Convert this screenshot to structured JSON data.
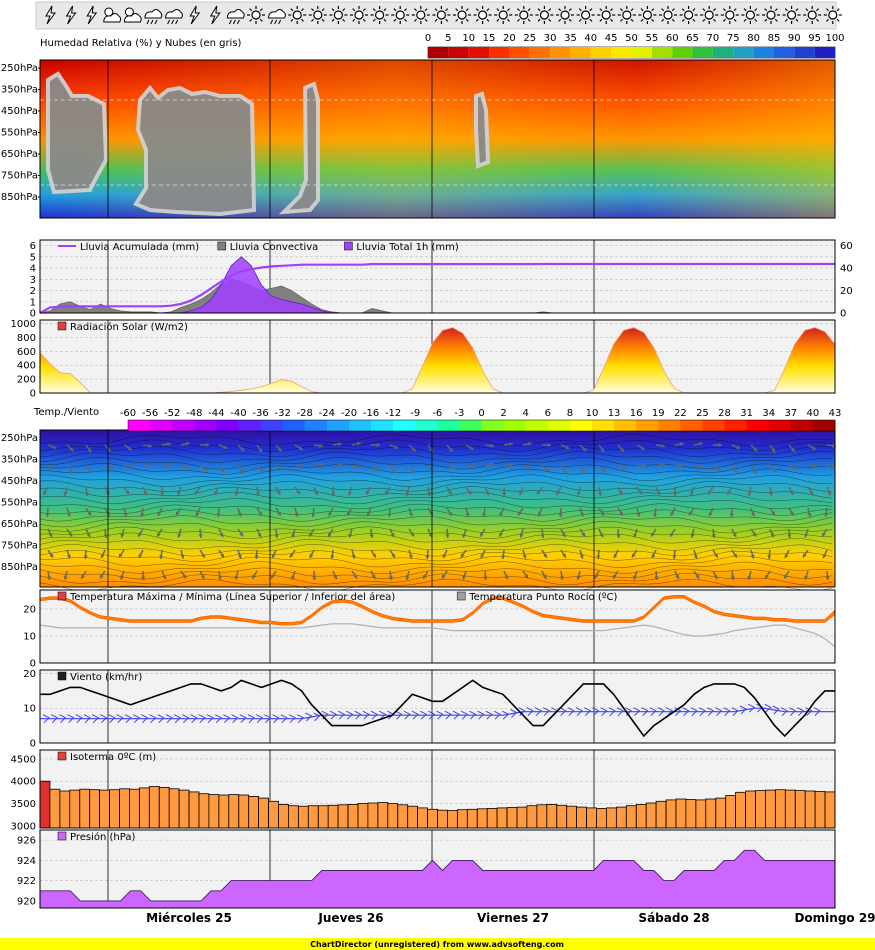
{
  "weather_icons": [
    "storm-icon",
    "storm-icon",
    "storm-icon",
    "cloud-sun-icon",
    "cloud-sun-icon",
    "cloud-rain-icon",
    "cloud-rain-icon",
    "storm-icon",
    "storm-icon",
    "cloud-rain-icon",
    "sun-icon",
    "cloud-rain-icon",
    "sun-icon",
    "sun-icon",
    "sun-icon",
    "sun-icon",
    "sun-icon",
    "sun-icon",
    "sun-icon",
    "sun-icon",
    "sun-icon",
    "sun-icon",
    "sun-icon",
    "sun-icon",
    "sun-icon",
    "sun-icon",
    "sun-icon",
    "sun-icon",
    "sun-icon",
    "sun-icon",
    "sun-icon",
    "sun-icon",
    "sun-icon",
    "sun-icon",
    "sun-icon",
    "sun-icon",
    "sun-icon",
    "sun-icon",
    "sun-icon"
  ],
  "days": [
    "Miércoles 25",
    "Jueves 26",
    "Viernes 27",
    "Sábado 28",
    "Domingo 29"
  ],
  "footer": "ChartDirector (unregistered) from www.advsofteng.com",
  "colors": {
    "humidity_low": "#2030d0",
    "humidity_high": "#c80000",
    "cloud": "#808080",
    "rain_total": "#a040ff",
    "rain_conv": "#808080",
    "radiation": "#ffcc00",
    "temp_max": "#ff8000",
    "dew": "#b0b0b0",
    "wind": "#000000",
    "gust": "#4040ff",
    "isotherm": "#ff9a40",
    "pressure": "#cc66ff"
  },
  "chart_data": [
    {
      "type": "heatmap",
      "title": "Humedad Relativa (%) y Nubes (en gris)",
      "y_ticks": [
        "250hPa",
        "350hPa",
        "450hPa",
        "550hPa",
        "650hPa",
        "750hPa",
        "850hPa"
      ],
      "scale_ticks": [
        "0",
        "5",
        "10",
        "15",
        "20",
        "25",
        "30",
        "35",
        "40",
        "45",
        "50",
        "55",
        "60",
        "65",
        "70",
        "75",
        "80",
        "85",
        "90",
        "95",
        "100"
      ]
    },
    {
      "type": "area",
      "legend": [
        "Lluvia Acumulada (mm)",
        "Lluvia Convectiva",
        "Lluvia Total 1h (mm)"
      ],
      "y_left_ticks": [
        "0",
        "1",
        "2",
        "3",
        "4",
        "5",
        "6"
      ],
      "y_right_ticks": [
        "0",
        "20",
        "40",
        "60"
      ],
      "ylim_left": [
        0,
        6.5
      ],
      "ylim_right": [
        0,
        65
      ],
      "rain_total_1h": [
        0,
        0,
        0,
        0,
        0,
        0,
        0,
        0,
        0,
        0,
        0,
        0,
        0,
        0,
        0,
        0.2,
        0.5,
        1.2,
        2.5,
        4.2,
        5.0,
        4.2,
        2.5,
        1.5,
        1.2,
        1.0,
        0.8,
        0.5,
        0.2,
        0,
        0,
        0,
        0,
        0,
        0,
        0,
        0,
        0,
        0,
        0,
        0,
        0,
        0,
        0,
        0,
        0,
        0,
        0,
        0,
        0,
        0,
        0,
        0,
        0,
        0,
        0,
        0,
        0,
        0,
        0,
        0,
        0,
        0,
        0,
        0,
        0,
        0,
        0,
        0,
        0,
        0,
        0,
        0,
        0,
        0,
        0,
        0,
        0,
        0,
        0
      ],
      "rain_convective": [
        0,
        0.2,
        0.8,
        1.0,
        0.6,
        0.3,
        0.8,
        0.4,
        0.2,
        0.1,
        0.1,
        0.1,
        0,
        0.1,
        0.5,
        0.8,
        1.2,
        1.8,
        2.6,
        3.0,
        2.8,
        2.4,
        2.0,
        2.2,
        2.4,
        2.0,
        1.4,
        0.8,
        0.3,
        0.1,
        0,
        0,
        0,
        0.4,
        0.2,
        0,
        0,
        0,
        0,
        0,
        0,
        0,
        0,
        0,
        0,
        0,
        0,
        0,
        0,
        0,
        0.1,
        0,
        0,
        0,
        0,
        0,
        0,
        0,
        0,
        0,
        0,
        0,
        0,
        0,
        0,
        0,
        0,
        0,
        0,
        0,
        0,
        0,
        0,
        0,
        0,
        0,
        0,
        0,
        0,
        0
      ],
      "rain_accumulated": [
        0,
        5,
        5.5,
        6,
        6,
        6,
        6,
        6,
        6,
        6,
        6,
        6,
        6,
        6.5,
        8,
        11,
        16,
        22,
        28,
        33,
        37,
        39,
        40.5,
        41.5,
        42,
        42.5,
        43,
        43,
        43,
        43,
        43,
        43,
        43,
        43.5,
        43.5,
        43.5,
        43.5,
        43.5,
        43.5,
        43.5,
        43.5,
        43.5,
        43.5,
        43.5,
        43.5,
        43.5,
        43.5,
        43.5,
        43.5,
        43.5,
        43.6,
        43.6,
        43.6,
        43.6,
        43.6,
        43.6,
        43.6,
        43.6,
        43.6,
        43.6,
        43.6,
        43.6,
        43.6,
        43.6,
        43.6,
        43.6,
        43.6,
        43.6,
        43.6,
        43.6,
        43.6,
        43.6,
        43.6,
        43.6,
        43.6,
        43.6,
        43.6,
        43.6,
        43.6,
        43.6
      ]
    },
    {
      "type": "area",
      "legend": [
        "Radiación Solar (W/m2)"
      ],
      "y_ticks": [
        "0",
        "200",
        "400",
        "600",
        "800",
        "1000"
      ],
      "ylim": [
        0,
        1050
      ],
      "values": [
        580,
        420,
        290,
        280,
        150,
        0,
        0,
        0,
        0,
        0,
        0,
        0,
        0,
        0,
        0,
        0,
        0,
        0,
        10,
        20,
        40,
        60,
        90,
        140,
        190,
        170,
        90,
        20,
        0,
        0,
        0,
        0,
        0,
        0,
        0,
        0,
        0,
        60,
        380,
        720,
        900,
        940,
        860,
        650,
        320,
        60,
        0,
        0,
        0,
        0,
        0,
        0,
        0,
        0,
        0,
        40,
        350,
        700,
        900,
        940,
        870,
        650,
        320,
        70,
        0,
        0,
        0,
        0,
        0,
        0,
        0,
        0,
        0,
        40,
        350,
        700,
        900,
        940,
        880,
        700
      ]
    },
    {
      "type": "heatmap",
      "title": "Temp./Viento",
      "y_ticks": [
        "250hPa",
        "350hPa",
        "450hPa",
        "550hPa",
        "650hPa",
        "750hPa",
        "850hPa"
      ],
      "scale_ticks": [
        "-60",
        "-56",
        "-52",
        "-48",
        "-44",
        "-40",
        "-36",
        "-32",
        "-28",
        "-24",
        "-20",
        "-16",
        "-12",
        "-9",
        "-6",
        "-3",
        "0",
        "2",
        "4",
        "6",
        "8",
        "10",
        "13",
        "16",
        "19",
        "22",
        "25",
        "28",
        "31",
        "34",
        "37",
        "40",
        "43"
      ]
    },
    {
      "type": "line",
      "legend": [
        "Temperatura Máxima / Mínima (Línea Superior / Inferior del área)",
        "Temperatura Punto Rocío (ºC)"
      ],
      "y_ticks": [
        "0",
        "10",
        "20"
      ],
      "ylim": [
        0,
        27
      ],
      "temp_max": [
        24,
        24.5,
        24.5,
        23.5,
        21,
        19,
        17.5,
        17,
        16.5,
        16,
        16,
        16,
        16,
        16,
        16,
        16,
        17,
        17.5,
        17.5,
        17,
        16.5,
        16,
        15.5,
        15.5,
        15,
        15,
        15.5,
        18,
        21,
        23,
        23.5,
        23,
        21.5,
        19.5,
        18,
        17,
        16.5,
        16,
        16,
        16,
        16,
        16,
        16.5,
        19,
        22.5,
        24.5,
        24.5,
        23,
        21.5,
        19.5,
        18,
        17.5,
        17,
        16.5,
        16,
        16,
        16,
        16,
        16,
        16,
        17.5,
        21,
        24.5,
        25,
        25,
        23,
        21.5,
        19.5,
        18.5,
        18,
        17.5,
        17,
        17,
        16.5,
        16.5,
        16,
        16,
        16,
        16,
        19.5
      ],
      "temp_min": [
        23,
        23.5,
        23.5,
        22.5,
        20,
        18,
        16.5,
        16,
        15.5,
        15,
        15,
        15,
        15,
        15,
        15,
        15,
        16,
        16.5,
        16.5,
        16,
        15.5,
        15,
        14.5,
        14.5,
        14,
        14,
        14.5,
        17,
        20,
        22,
        22.5,
        22,
        20.5,
        18.5,
        17,
        16,
        15.5,
        15,
        15,
        15,
        15,
        15,
        15.5,
        18,
        21.5,
        23.5,
        23.5,
        22,
        20.5,
        18.5,
        17,
        16.5,
        16,
        15.5,
        15,
        15,
        15,
        15,
        15,
        15,
        16.5,
        20,
        23.5,
        24,
        24,
        22,
        20.5,
        18.5,
        17.5,
        17,
        16.5,
        16,
        16,
        15.5,
        15.5,
        15,
        15,
        15,
        15,
        18
      ],
      "dew": [
        14,
        13.5,
        13,
        13,
        13,
        13,
        13,
        13,
        13,
        13,
        13,
        13,
        13,
        13,
        13,
        13,
        13,
        13,
        13,
        13,
        13,
        13,
        13,
        13,
        13,
        13,
        13,
        13.5,
        14,
        14.5,
        14.5,
        14.5,
        14,
        13.5,
        13,
        13,
        13,
        13,
        13,
        13,
        12.5,
        12,
        12,
        12,
        12,
        12,
        12,
        12,
        12,
        12,
        12,
        12,
        12,
        12,
        12,
        12,
        12,
        12.5,
        13,
        13.5,
        14,
        13.5,
        12.5,
        11.5,
        10.5,
        10,
        10,
        10.5,
        11,
        12,
        12.5,
        13,
        13.5,
        14,
        14,
        13,
        12,
        11,
        9,
        6
      ]
    },
    {
      "type": "line",
      "legend": [
        "Viento (km/hr)"
      ],
      "y_ticks": [
        "0",
        "10",
        "20"
      ],
      "ylim": [
        0,
        21
      ],
      "wind": [
        14,
        14,
        15,
        16,
        16,
        15,
        14,
        13,
        12,
        11,
        12,
        13,
        14,
        15,
        16,
        17,
        17,
        16,
        15,
        16,
        18,
        17,
        16,
        17,
        18,
        17,
        15,
        11,
        8,
        5,
        5,
        5,
        5,
        6,
        7,
        8,
        11,
        14,
        13,
        12,
        12,
        14,
        16,
        18,
        16,
        15,
        14,
        11,
        8,
        5,
        5,
        8,
        11,
        14,
        17,
        17,
        17,
        14,
        10,
        6,
        2,
        5,
        7,
        9,
        11,
        14,
        16,
        17,
        17,
        17,
        16,
        13,
        9,
        5,
        2,
        5,
        8,
        12,
        15,
        15
      ],
      "gust": [
        7,
        7,
        7,
        7,
        7,
        7,
        7,
        7,
        7,
        7,
        7,
        7,
        7,
        7,
        7,
        7,
        7,
        7,
        7,
        7,
        7,
        7,
        7,
        7,
        7,
        7,
        7,
        7.5,
        8,
        8,
        8,
        8,
        8,
        8,
        8,
        8,
        8,
        8,
        8,
        8,
        8,
        8,
        8,
        8,
        8,
        8,
        8,
        8.5,
        9,
        9,
        9,
        9,
        9,
        9,
        9,
        9,
        9,
        9,
        9,
        9,
        9,
        9,
        9,
        9,
        9,
        9,
        9,
        9,
        9,
        9,
        9.5,
        10,
        10,
        9.5,
        9,
        9,
        9,
        9,
        9,
        9
      ]
    },
    {
      "type": "bar",
      "legend": [
        "Isoterma 0ºC (m)"
      ],
      "y_ticks": [
        "3000",
        "3500",
        "4000",
        "4500"
      ],
      "ylim": [
        2950,
        4700
      ],
      "values": [
        4000,
        3820,
        3780,
        3800,
        3820,
        3810,
        3800,
        3810,
        3830,
        3820,
        3850,
        3880,
        3860,
        3830,
        3800,
        3760,
        3720,
        3700,
        3690,
        3700,
        3690,
        3660,
        3620,
        3550,
        3480,
        3450,
        3440,
        3450,
        3450,
        3460,
        3470,
        3480,
        3500,
        3510,
        3520,
        3500,
        3470,
        3440,
        3400,
        3370,
        3350,
        3340,
        3360,
        3370,
        3380,
        3390,
        3400,
        3410,
        3420,
        3450,
        3470,
        3480,
        3460,
        3440,
        3420,
        3400,
        3390,
        3400,
        3420,
        3450,
        3480,
        3510,
        3550,
        3580,
        3600,
        3590,
        3580,
        3600,
        3620,
        3680,
        3750,
        3780,
        3790,
        3800,
        3810,
        3800,
        3790,
        3780,
        3770,
        3760
      ]
    },
    {
      "type": "area",
      "legend": [
        "Presión (hPa)"
      ],
      "y_ticks": [
        "920",
        "922",
        "924",
        "926"
      ],
      "ylim": [
        919.3,
        927
      ],
      "values": [
        921,
        921,
        921,
        921,
        920,
        920,
        920,
        920,
        920,
        921,
        921,
        920,
        920,
        920,
        920,
        920,
        920,
        921,
        921,
        922,
        922,
        922,
        922,
        922,
        922,
        922,
        922,
        922,
        923,
        923,
        923,
        923,
        923,
        923,
        923,
        923,
        923,
        923,
        923,
        924,
        923,
        924,
        924,
        924,
        923,
        923,
        923,
        923,
        923,
        923,
        923,
        923,
        923,
        923,
        923,
        923,
        924,
        924,
        924,
        924,
        923,
        923,
        922,
        922,
        923,
        923,
        923,
        923,
        924,
        924,
        925,
        925,
        924,
        924,
        924,
        924,
        924,
        924,
        924,
        924
      ]
    }
  ]
}
